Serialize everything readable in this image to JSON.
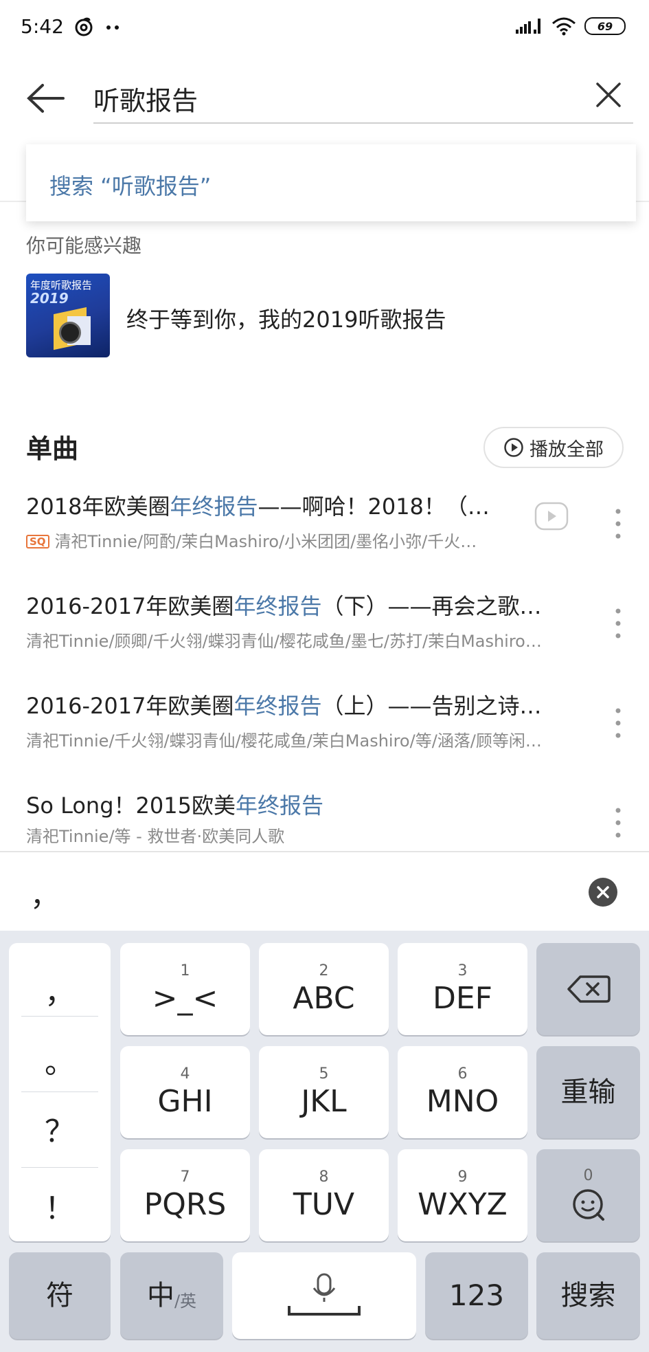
{
  "status": {
    "time": "5:42",
    "battery": "69"
  },
  "search": {
    "value": "听歌报告",
    "suggestion": "搜索 “听歌报告”"
  },
  "interest": {
    "label": "你可能感兴趣",
    "thumb_line1": "年度听歌报告",
    "thumb_line2": "2019",
    "title": "终于等到你，我的2019听歌报告"
  },
  "songs_section": {
    "title": "单曲",
    "play_all": "播放全部"
  },
  "songs": [
    {
      "title_pre": "2018年欧美圈",
      "title_hl": "年终报告",
      "title_post": "——啊哈！2018！（…",
      "badge": "SQ",
      "subtitle": "清祀Tinnie/阿酌/茉白Mashiro/小米团团/墨佲小弥/千火…"
    },
    {
      "title_pre": "2016-2017年欧美圈",
      "title_hl": "年终报告",
      "title_post": "（下）——再会之歌…",
      "subtitle": "清祀Tinnie/顾卿/千火翎/蝶羽青仙/樱花咸鱼/墨七/苏打/茉白Mashiro…"
    },
    {
      "title_pre": "2016-2017年欧美圈",
      "title_hl": "年终报告",
      "title_post": "（上）——告别之诗…",
      "subtitle": "清祀Tinnie/千火翎/蝶羽青仙/樱花咸鱼/茉白Mashiro/等/涵落/顾等闲…"
    },
    {
      "title_pre": "So Long！2015欧美",
      "title_hl": "年终报告",
      "title_post": "",
      "subtitle": "清祀Tinnie/等 - 救世者·欧美同人歌"
    }
  ],
  "candidate": {
    "char": "，"
  },
  "keyboard": {
    "punct": [
      "，",
      "。",
      "？",
      "！"
    ],
    "keys": [
      {
        "num": "1",
        "label": ">_<"
      },
      {
        "num": "2",
        "label": "ABC"
      },
      {
        "num": "3",
        "label": "DEF"
      },
      {
        "num": "4",
        "label": "GHI"
      },
      {
        "num": "5",
        "label": "JKL"
      },
      {
        "num": "6",
        "label": "MNO"
      },
      {
        "num": "7",
        "label": "PQRS"
      },
      {
        "num": "8",
        "label": "TUV"
      },
      {
        "num": "9",
        "label": "WXYZ"
      },
      {
        "num": "0",
        "label": "emoji-icon"
      }
    ],
    "retype": "重输",
    "symbols": "符",
    "lang_main": "中",
    "lang_alt": "/英",
    "numbers": "123",
    "search": "搜索"
  },
  "colors": {
    "highlight": "#4b78a8",
    "badge": "#e8753a",
    "keyboard_bg": "#e6e9ef",
    "dark_key": "#c3c8d2"
  }
}
